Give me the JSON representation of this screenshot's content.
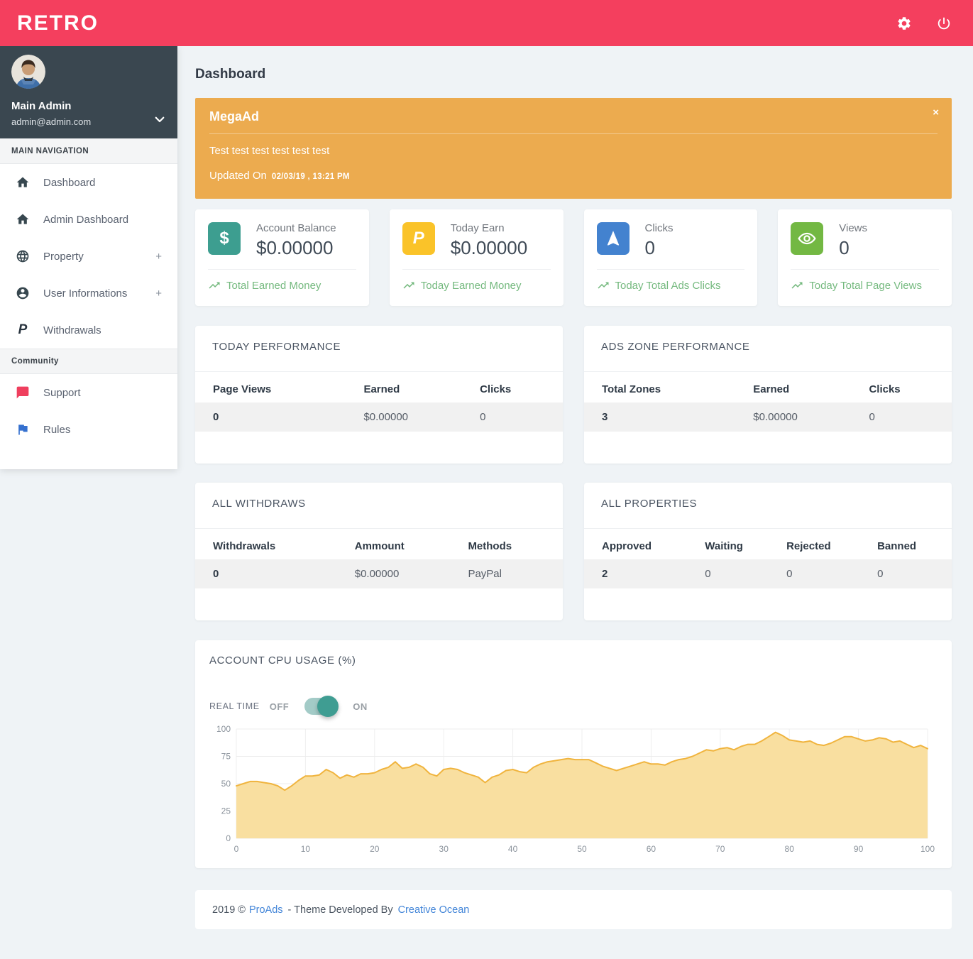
{
  "topbar": {
    "brand": "RETRO"
  },
  "sidebar": {
    "user": {
      "name": "Main Admin",
      "email": "admin@admin.com"
    },
    "nav_header": "MAIN NAVIGATION",
    "nav": [
      {
        "label": "Dashboard",
        "icon": "home-icon"
      },
      {
        "label": "Admin Dashboard",
        "icon": "home-icon"
      },
      {
        "label": "Property",
        "icon": "globe-icon",
        "expand": "+"
      },
      {
        "label": "User Informations",
        "icon": "user-circle-icon",
        "expand": "+"
      },
      {
        "label": "Withdrawals",
        "icon": "paypal-icon",
        "glyph": "P"
      }
    ],
    "community_header": "Community",
    "community": [
      {
        "label": "Support",
        "icon": "chat-icon",
        "color": "#ef3f5e"
      },
      {
        "label": "Rules",
        "icon": "flag-icon",
        "color": "#3570cf"
      }
    ]
  },
  "page": {
    "title": "Dashboard"
  },
  "banner": {
    "title": "MegaAd",
    "close": "×",
    "message": "Test test test test test test",
    "updated_label": "Updated On",
    "updated_value": "02/03/19 , 13:21 PM",
    "color": "#ecab4f"
  },
  "stats": [
    {
      "label": "Account Balance",
      "value": "$0.00000",
      "footer": "Total Earned Money",
      "icon": "dollar-icon",
      "glyph": "$",
      "color": "#3d9e90"
    },
    {
      "label": "Today Earn",
      "value": "$0.00000",
      "footer": "Today Earned Money",
      "icon": "paypal-icon",
      "glyph": "P",
      "color": "#fac329"
    },
    {
      "label": "Clicks",
      "value": "0",
      "footer": "Today Total Ads Clicks",
      "icon": "navigation-arrow-icon",
      "color": "#4382cf"
    },
    {
      "label": "Views",
      "value": "0",
      "footer": "Today Total Page Views",
      "icon": "eye-icon",
      "color": "#73b843"
    }
  ],
  "tables": [
    {
      "title": "TODAY PERFORMANCE",
      "headers": [
        "Page Views",
        "Earned",
        "Clicks"
      ],
      "row": [
        "0",
        "$0.00000",
        "0"
      ]
    },
    {
      "title": "ADS ZONE PERFORMANCE",
      "headers": [
        "Total Zones",
        "Earned",
        "Clicks"
      ],
      "row": [
        "3",
        "$0.00000",
        "0"
      ]
    },
    {
      "title": "ALL WITHDRAWS",
      "headers": [
        "Withdrawals",
        "Ammount",
        "Methods"
      ],
      "row": [
        "0",
        "$0.00000",
        "PayPal"
      ]
    },
    {
      "title": "ALL PROPERTIES",
      "headers": [
        "Approved",
        "Waiting",
        "Rejected",
        "Banned"
      ],
      "row": [
        "2",
        "0",
        "0",
        "0"
      ]
    }
  ],
  "cpu": {
    "title": "ACCOUNT CPU USAGE (%)",
    "realtime_label": "REAL TIME",
    "off": "OFF",
    "on": "ON",
    "toggle_state": "on",
    "toggle_color": "#3f9d92"
  },
  "chart_data": {
    "type": "area",
    "title": "ACCOUNT CPU USAGE (%)",
    "xlabel": "",
    "ylabel": "",
    "xlim": [
      0,
      100
    ],
    "ylim": [
      0,
      100
    ],
    "xticks": [
      0,
      10,
      20,
      30,
      40,
      50,
      60,
      70,
      80,
      90,
      100
    ],
    "yticks": [
      0,
      25,
      50,
      75,
      100
    ],
    "grid": true,
    "legend": "none",
    "line_color": "#f0b43e",
    "fill_color": "#f9dfa0",
    "x_start": 0,
    "x_step": 1,
    "values": [
      48,
      50,
      52,
      52,
      51,
      50,
      48,
      44,
      48,
      53,
      57,
      57,
      58,
      63,
      60,
      55,
      58,
      56,
      59,
      59,
      60,
      63,
      65,
      70,
      64,
      65,
      68,
      65,
      59,
      57,
      63,
      64,
      63,
      60,
      58,
      56,
      51,
      56,
      58,
      62,
      63,
      61,
      60,
      65,
      68,
      70,
      71,
      72,
      73,
      72,
      72,
      72,
      69,
      66,
      64,
      62,
      64,
      66,
      68,
      70,
      68,
      68,
      67,
      70,
      72,
      73,
      75,
      78,
      81,
      80,
      82,
      83,
      81,
      84,
      86,
      86,
      89,
      93,
      97,
      94,
      90,
      89,
      88,
      89,
      86,
      85,
      87,
      90,
      93,
      93,
      91,
      89,
      90,
      92,
      91,
      88,
      89,
      86,
      83,
      85,
      82
    ]
  },
  "footer": {
    "prefix": "2019 ©",
    "link1": "ProAds",
    "middle": "- Theme Developed By",
    "link2": "Creative Ocean"
  }
}
